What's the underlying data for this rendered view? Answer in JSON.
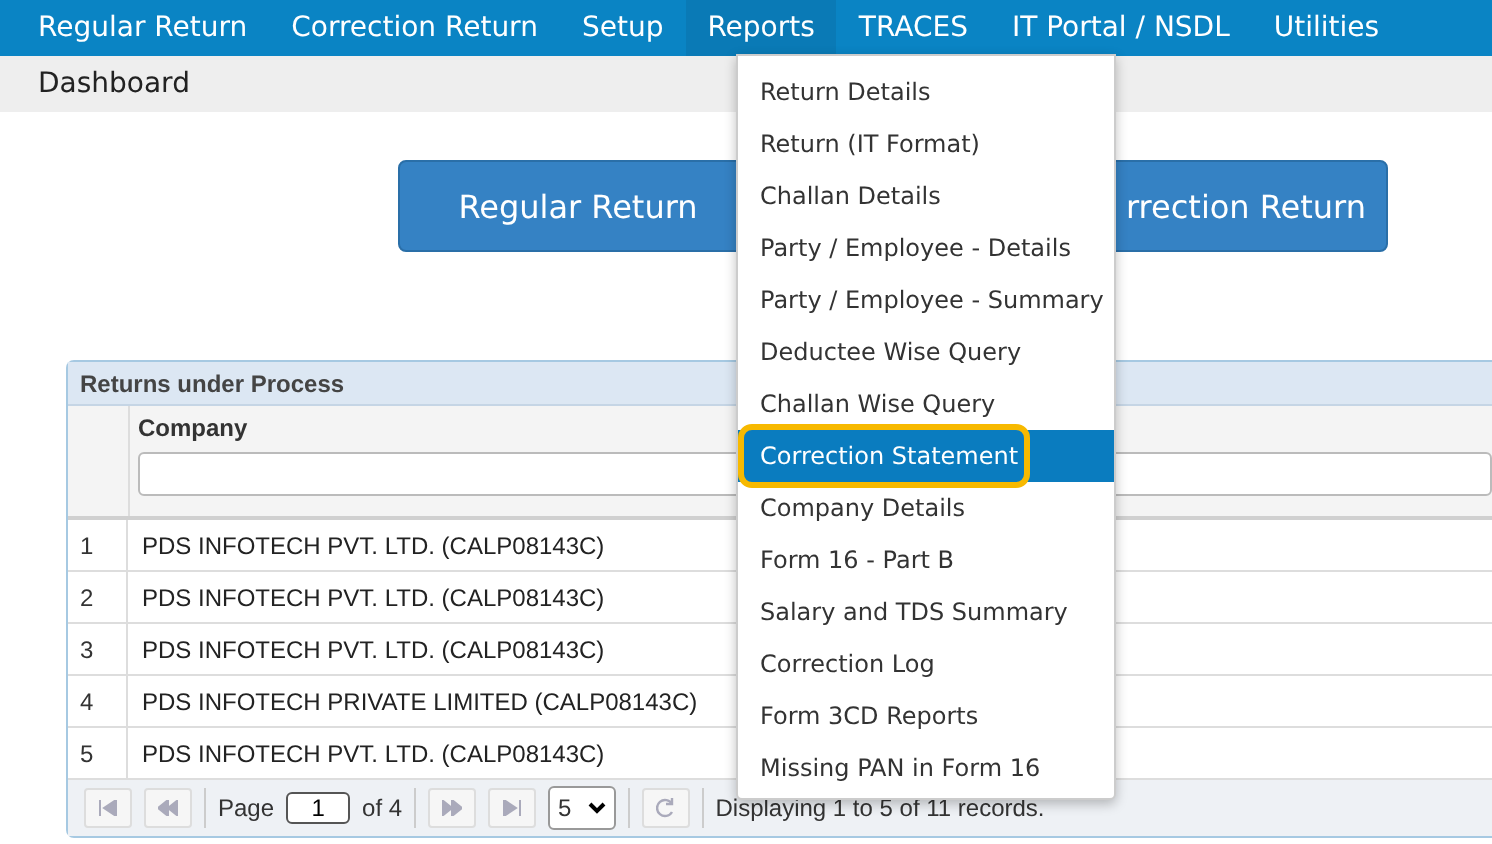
{
  "nav": [
    {
      "label": "Regular Return",
      "selected": false
    },
    {
      "label": "Correction Return",
      "selected": false
    },
    {
      "label": "Setup",
      "selected": false
    },
    {
      "label": "Reports",
      "selected": true
    },
    {
      "label": "TRACES",
      "selected": false
    },
    {
      "label": "IT Portal / NSDL",
      "selected": false
    },
    {
      "label": "Utilities",
      "selected": false
    }
  ],
  "breadcrumb": "Dashboard",
  "actions": [
    "Regular Return",
    "rrection Return"
  ],
  "reports_menu": [
    {
      "label": "Return Details",
      "selected": false
    },
    {
      "label": "Return (IT Format)",
      "selected": false
    },
    {
      "label": "Challan Details",
      "selected": false
    },
    {
      "label": "Party / Employee - Details",
      "selected": false
    },
    {
      "label": "Party / Employee - Summary",
      "selected": false
    },
    {
      "label": "Deductee Wise Query",
      "selected": false
    },
    {
      "label": "Challan Wise Query",
      "selected": false
    },
    {
      "label": "Correction Statement",
      "selected": true
    },
    {
      "label": "Company Details",
      "selected": false
    },
    {
      "label": "Form 16 - Part B",
      "selected": false
    },
    {
      "label": "Salary and TDS Summary",
      "selected": false
    },
    {
      "label": "Correction Log",
      "selected": false
    },
    {
      "label": "Form 3CD Reports",
      "selected": false
    },
    {
      "label": "Missing PAN in Form 16",
      "selected": false
    }
  ],
  "grid": {
    "title": "Returns under Process",
    "columns": [
      "Company"
    ],
    "rows": [
      {
        "number": "1",
        "company": "PDS INFOTECH PVT. LTD. (CALP08143C)"
      },
      {
        "number": "2",
        "company": "PDS INFOTECH PVT. LTD. (CALP08143C)"
      },
      {
        "number": "3",
        "company": "PDS INFOTECH PVT. LTD. (CALP08143C)"
      },
      {
        "number": "4",
        "company": "PDS INFOTECH PRIVATE LIMITED (CALP08143C)"
      },
      {
        "number": "5",
        "company": "PDS INFOTECH PVT. LTD. (CALP08143C)"
      }
    ],
    "pager": {
      "page_label": "Page",
      "page": "1",
      "of_label": "of 4",
      "page_size": "5",
      "info": "Displaying 1 to 5 of 11 records."
    }
  }
}
